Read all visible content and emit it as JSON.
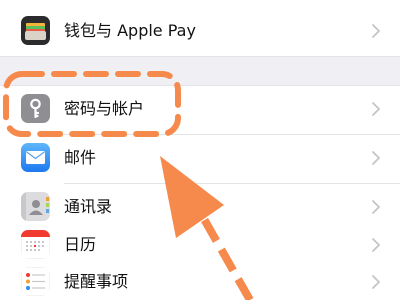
{
  "settings_rows": [
    {
      "label": "钱包与 Apple Pay",
      "icon": "wallet-icon"
    },
    {
      "label": "密码与帐户",
      "icon": "key-icon"
    },
    {
      "label": "邮件",
      "icon": "mail-icon"
    },
    {
      "label": "通讯录",
      "icon": "contacts-icon"
    },
    {
      "label": "日历",
      "icon": "calendar-icon"
    },
    {
      "label": "提醒事项",
      "icon": "reminders-icon"
    }
  ],
  "colors": {
    "annotation": "#f58a4c",
    "group_gap": "#efeff4",
    "mail_blue": "#2b8df7",
    "key_gray": "#8e8e93",
    "calendar_red": "#f23b30"
  }
}
